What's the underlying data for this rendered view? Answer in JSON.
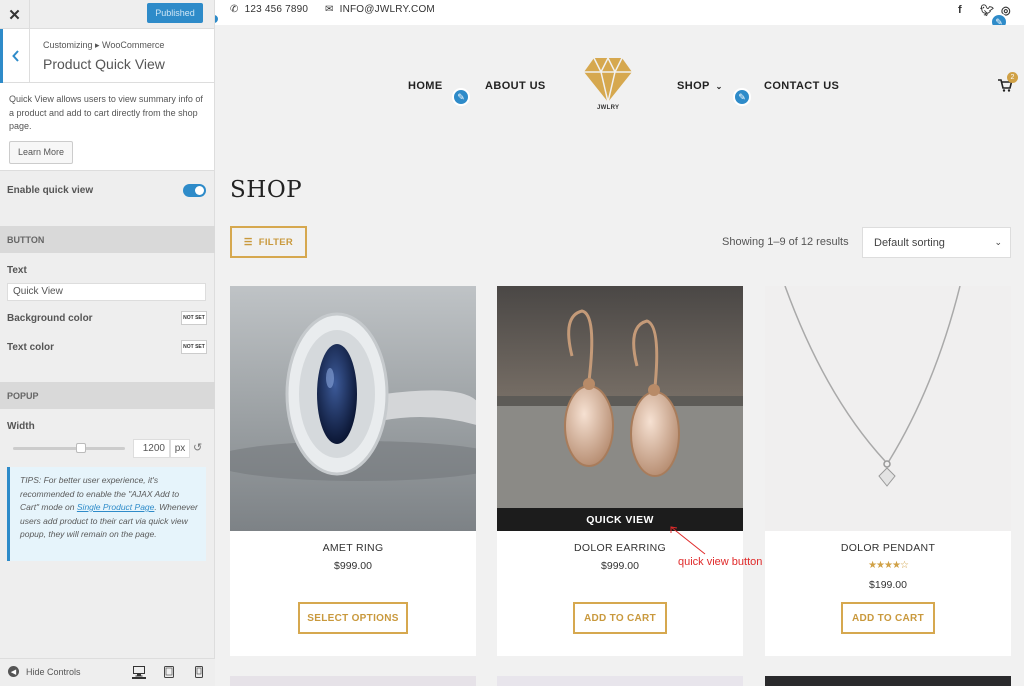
{
  "customizer": {
    "close_label": "✕",
    "publish_label": "Published",
    "breadcrumb": "Customizing ▸ WooCommerce",
    "section_title": "Product Quick View",
    "description": "Quick View allows users to view summary info of a product and add to cart directly from the shop page.",
    "learn_more_label": "Learn More",
    "enable_label": "Enable quick view",
    "button_section": "BUTTON",
    "text_label": "Text",
    "text_value": "Quick View",
    "bg_color_label": "Background color",
    "text_color_label": "Text color",
    "not_set": "NOT SET",
    "popup_section": "POPUP",
    "width_label": "Width",
    "width_value": "1200",
    "width_unit": "px",
    "width_slider_fraction": 0.6,
    "tips_prefix": "TIPS: For better user experience, it's recommended to enable the \"AJAX Add to Cart\" mode on ",
    "tips_link": "Single Product Page",
    "tips_suffix": ". Whenever users add product to their cart via quick view popup, they will remain on the page.",
    "hide_controls_label": "Hide Controls"
  },
  "site": {
    "phone": "123 456 7890",
    "email": "INFO@JWLRY.COM",
    "nav": {
      "home": "HOME",
      "about": "ABOUT US",
      "shop": "SHOP",
      "contact": "CONTACT US"
    },
    "logo_text": "JWLRY",
    "cart_count": "2",
    "page_title": "SHOP",
    "filter_label": "FILTER",
    "results_text": "Showing 1–9 of 12 results",
    "sort_value": "Default sorting",
    "products": [
      {
        "name": "AMET RING",
        "price": "$999.00",
        "button": "SELECT OPTIONS"
      },
      {
        "name": "DOLOR EARRING",
        "price": "$999.00",
        "button": "ADD TO CART",
        "quick_view": "QUICK VIEW"
      },
      {
        "name": "DOLOR PENDANT",
        "price": "$199.00",
        "button": "ADD TO CART",
        "rating": 4
      }
    ],
    "annotation": "quick view button"
  },
  "colors": {
    "accent_blue": "#2e8bc9",
    "gold": "#d6a84f",
    "annotation_red": "#e02a2a"
  }
}
